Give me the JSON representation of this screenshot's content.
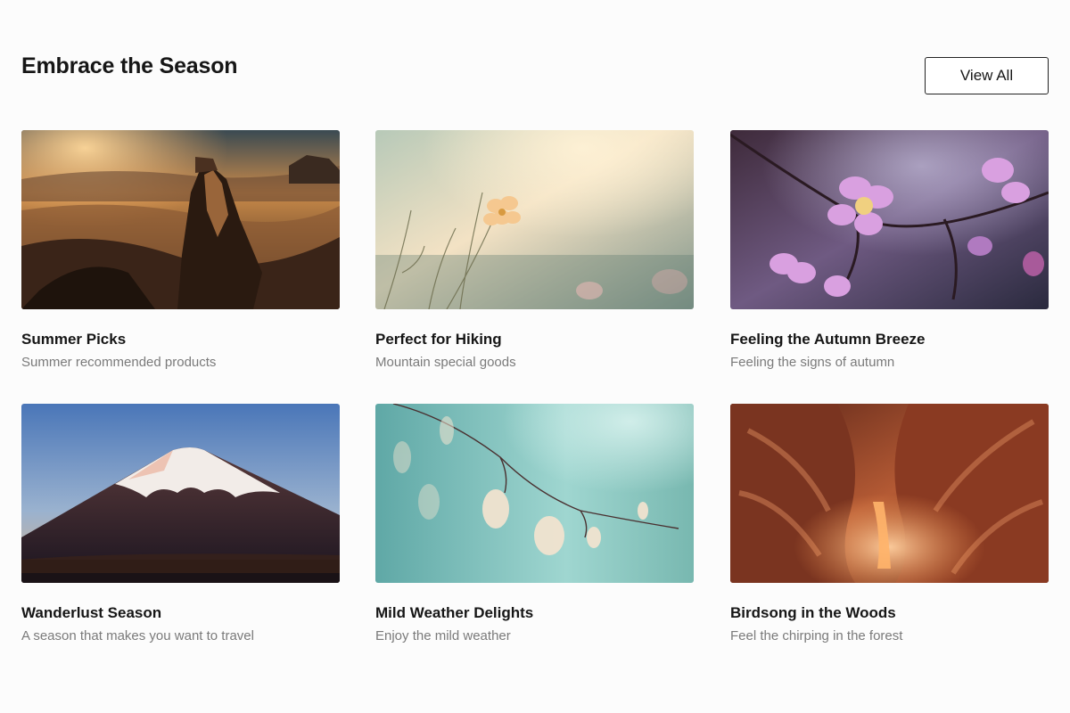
{
  "section": {
    "title": "Embrace the Season",
    "view_all_label": "View All"
  },
  "cards": [
    {
      "title": "Summer Picks",
      "description": "Summer recommended products",
      "image": "desert-rock-formations-sunset"
    },
    {
      "title": "Perfect for Hiking",
      "description": "Mountain special goods",
      "image": "wildflower-soft-focus"
    },
    {
      "title": "Feeling the Autumn Breeze",
      "description": "Feeling the signs of autumn",
      "image": "pink-cherry-blossoms"
    },
    {
      "title": "Wanderlust Season",
      "description": "A season that makes you want to travel",
      "image": "snowcapped-volcano-mountain"
    },
    {
      "title": "Mild Weather Delights",
      "description": "Enjoy the mild weather",
      "image": "translucent-leaves-teal"
    },
    {
      "title": "Birdsong in the Woods",
      "description": "Feel the chirping in the forest",
      "image": "sandstone-slot-canyon"
    }
  ]
}
